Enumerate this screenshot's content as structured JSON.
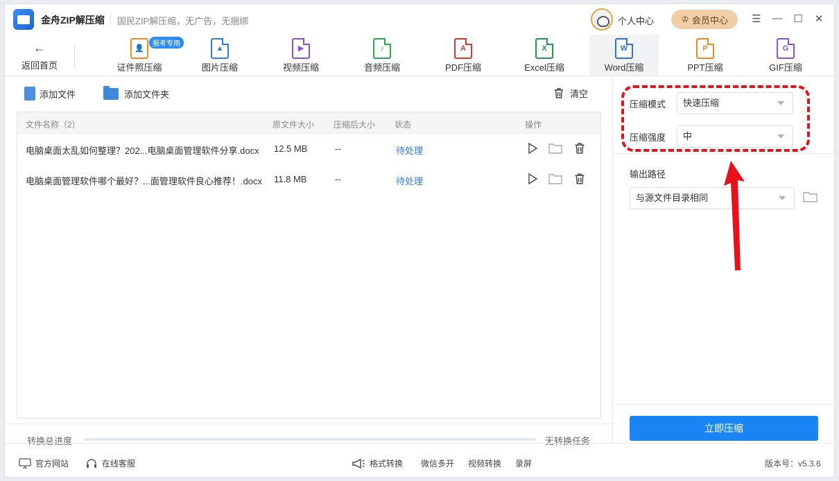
{
  "app": {
    "title": "金舟ZIP解压缩",
    "slogan": "国民ZIP解压缩，无广告，无捆绑",
    "personal_center": "个人中心",
    "vip_label": "会员中心"
  },
  "toolbar": {
    "back_label": "返回首页",
    "badge": "报考专用",
    "tools": [
      {
        "label": "证件照压缩",
        "icon": "id-photo-icon",
        "color": "#f08a1c",
        "glyph": "👤"
      },
      {
        "label": "图片压缩",
        "icon": "image-file-icon",
        "color": "#2e7be0",
        "glyph": "▲"
      },
      {
        "label": "视频压缩",
        "icon": "video-file-icon",
        "color": "#8a4fd8",
        "glyph": "▶"
      },
      {
        "label": "音频压缩",
        "icon": "audio-file-icon",
        "color": "#2aa84e",
        "glyph": "♪"
      },
      {
        "label": "PDF压缩",
        "icon": "pdf-file-icon",
        "color": "#e0352b",
        "glyph": "A"
      },
      {
        "label": "Excel压缩",
        "icon": "excel-file-icon",
        "color": "#1f9a4a",
        "glyph": "X"
      },
      {
        "label": "Word压缩",
        "icon": "word-file-icon",
        "color": "#2d6fdc",
        "glyph": "W"
      },
      {
        "label": "PPT压缩",
        "icon": "ppt-file-icon",
        "color": "#f0891b",
        "glyph": "P"
      },
      {
        "label": "GIF压缩",
        "icon": "gif-file-icon",
        "color": "#8f4fd8",
        "glyph": "G"
      }
    ]
  },
  "actions": {
    "add_file": "添加文件",
    "add_folder": "添加文件夹",
    "clear": "清空"
  },
  "table": {
    "headers": {
      "name": "文件名称（2）",
      "orig_size": "原文件大小",
      "comp_size": "压缩后大小",
      "status": "状态",
      "ops": "操作"
    },
    "rows": [
      {
        "name": "电脑桌面太乱如何整理？202...电脑桌面管理软件分享.docx",
        "orig_size": "12.5 MB",
        "comp_size": "--",
        "status": "待处理"
      },
      {
        "name": "电脑桌面管理软件哪个最好？...面管理软件良心推荐！.docx",
        "orig_size": "11.8 MB",
        "comp_size": "--",
        "status": "待处理"
      }
    ]
  },
  "progress": {
    "label": "转换总进度",
    "value": 0,
    "status": "无转换任务"
  },
  "settings": {
    "mode_label": "压缩模式",
    "mode_value": "快速压缩",
    "strength_label": "压缩强度",
    "strength_value": "中",
    "output_label": "输出路径",
    "output_value": "与源文件目录相同",
    "compress_button": "立即压缩"
  },
  "footer": {
    "website": "官方网站",
    "service": "在线客服",
    "format_convert": "格式转换",
    "wechat_multi": "微信多开",
    "video_convert": "视频转换",
    "screen_record": "录屏",
    "version": "版本号：v5.3.6"
  }
}
